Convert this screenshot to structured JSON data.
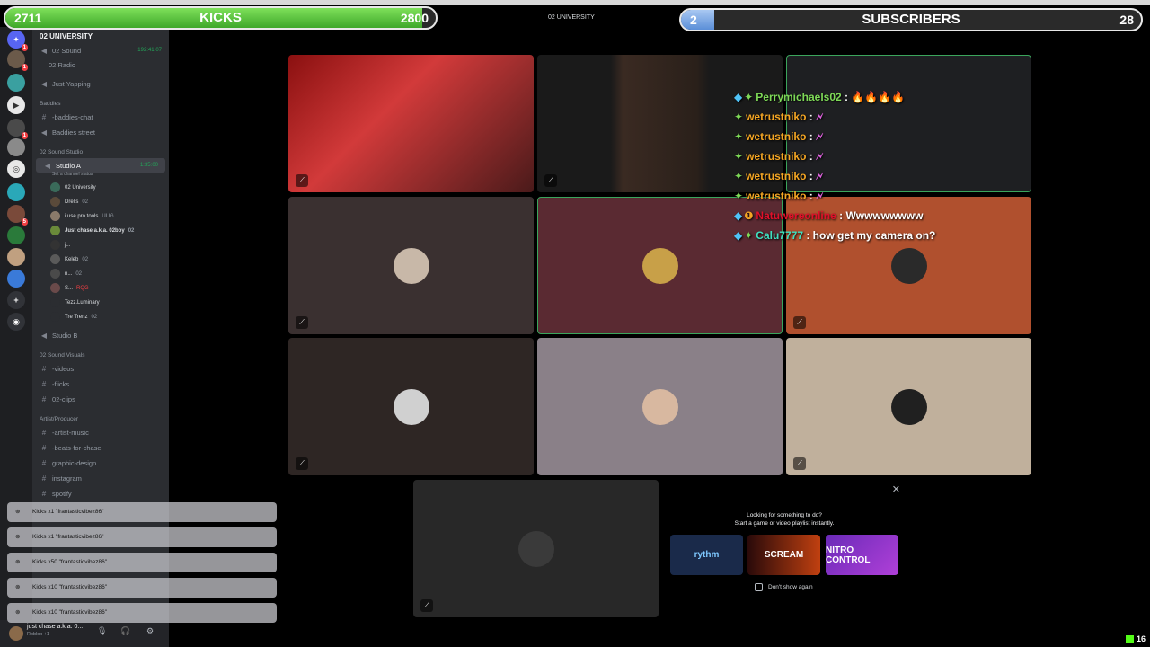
{
  "overlay": {
    "kicks": {
      "current": "2711",
      "label": "KICKS",
      "goal": "2800",
      "progress": 0.9689
    },
    "subs": {
      "current": "2",
      "label": "SUBSCRIBERS",
      "goal": "28",
      "progress": 0.0714
    }
  },
  "window": {
    "title": "02 UNIVERSITY"
  },
  "sidebar": {
    "server_name": "02 UNIVERSITY",
    "channels": [
      {
        "name": "02 Sound",
        "time": "192:41:07"
      },
      {
        "name": "02 Radio"
      },
      {
        "name": "Just Yapping"
      },
      {
        "name": "Baddies"
      },
      {
        "name": "-baddies-chat"
      },
      {
        "name": "Baddies street"
      },
      {
        "name": "02 Sound Studio"
      },
      {
        "name": "Studio A",
        "time": "1:35:00",
        "sub": "Set a channel status"
      }
    ],
    "voice_users": [
      {
        "name": "02 University"
      },
      {
        "name": "Drells",
        "tag": "02"
      },
      {
        "name": "i use pro tools",
        "tag": "UUG"
      },
      {
        "name": "Just chase a.k.a. 02boy",
        "tag": "02"
      },
      {
        "name": "j..."
      },
      {
        "name": "Keleb",
        "tag": "02"
      },
      {
        "name": "n...",
        "tag": "02"
      },
      {
        "name": "S...",
        "tag": "RQG"
      },
      {
        "name": "Tezz.Luminary"
      },
      {
        "name": "Tre Trenz",
        "tag": "02"
      }
    ],
    "channels2": [
      {
        "name": "Studio B"
      },
      {
        "name": "02 Sound Visuals"
      },
      {
        "name": "-videos"
      },
      {
        "name": "-flicks"
      },
      {
        "name": "02-clips"
      },
      {
        "name": "Artist/Producer"
      },
      {
        "name": "-artist-music"
      },
      {
        "name": "-beats-for-chase"
      },
      {
        "name": "graphic-design"
      },
      {
        "name": "instagram"
      },
      {
        "name": "spotify"
      }
    ]
  },
  "toasts": [
    {
      "text": "Kicks x1 \"frantasticvibez86\""
    },
    {
      "text": "Kicks x1 \"frantasticvibez86\""
    },
    {
      "text": "Kicks x50 \"frantasticvibez86\""
    },
    {
      "text": "Kicks x10 \"frantasticvibez86\""
    },
    {
      "text": "Kicks x10 \"frantasticvibez86\""
    }
  ],
  "chat": [
    {
      "user": "Perrymichaels02",
      "text": "🔥🔥🔥🔥"
    },
    {
      "user": "wetrustniko",
      "text": "🗲"
    },
    {
      "user": "wetrustniko",
      "text": "🗲"
    },
    {
      "user": "wetrustniko",
      "text": "🗲"
    },
    {
      "user": "wetrustniko",
      "text": "🗲"
    },
    {
      "user": "wetrustniko",
      "text": "🗲"
    },
    {
      "user": "Natuwereonline",
      "text": "Wwwwwwwww"
    },
    {
      "user": "Calu7777",
      "text": "how get my camera on?"
    }
  ],
  "activity": {
    "title": "Looking for something to do?",
    "subtitle": "Start a game or video playlist instantly.",
    "tiles": [
      "rythm",
      "SCREAM",
      "NITRO CONTROL"
    ],
    "dont_show": "Don't show again"
  },
  "user_panel": {
    "name": "just chase a.k.a. 0...",
    "status": "Roblox +1"
  },
  "viewer_count": "16",
  "colors": {
    "kicks_green": "#57d33b",
    "subs_blue": "#7aa8e8",
    "accent": "#53fc18"
  }
}
